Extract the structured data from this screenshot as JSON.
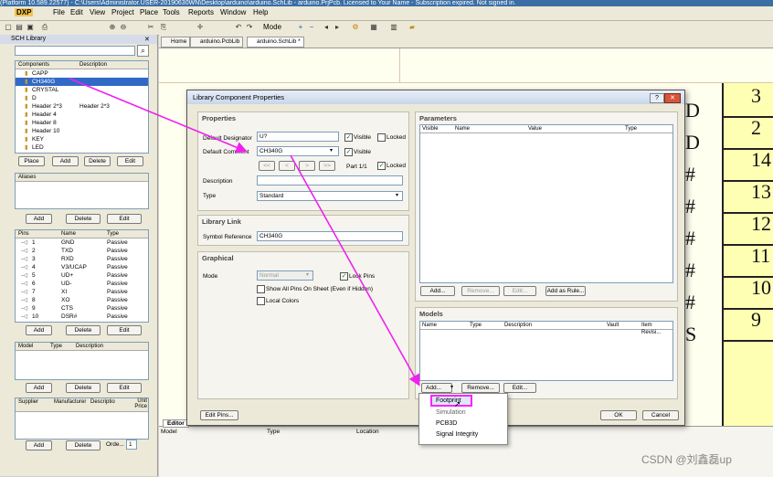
{
  "app": {
    "title": "(Platform 10.589.22577) - C:\\Users\\Administrator.USER-20190630WN\\Desktop\\arduino\\arduino.SchLib - arduino.PrjPcb. Licensed to Your Name - Subscription expired. Not signed in.",
    "logo": "DXP"
  },
  "menu": [
    "File",
    "Edit",
    "View",
    "Project",
    "Place",
    "Tools",
    "Reports",
    "Window",
    "Help"
  ],
  "toolbar": {
    "mode_label": "Mode"
  },
  "sch_library": {
    "title": "SCH Library",
    "components_header": {
      "col1": "Components",
      "col2": "Description"
    },
    "components": [
      {
        "name": "CAPP",
        "desc": ""
      },
      {
        "name": "CH340G",
        "desc": "",
        "selected": true
      },
      {
        "name": "CRYSTAL",
        "desc": ""
      },
      {
        "name": "D",
        "desc": ""
      },
      {
        "name": "Header 2*3",
        "desc": "Header 2*3"
      },
      {
        "name": "Header 4",
        "desc": ""
      },
      {
        "name": "Header 8",
        "desc": ""
      },
      {
        "name": "Header 10",
        "desc": ""
      },
      {
        "name": "KEY",
        "desc": ""
      },
      {
        "name": "LED",
        "desc": ""
      }
    ],
    "comp_buttons": [
      "Place",
      "Add",
      "Delete",
      "Edit"
    ],
    "aliases_header": "Aliases",
    "alias_buttons": [
      "Add",
      "Delete",
      "Edit"
    ],
    "pins_header": {
      "col1": "Pins",
      "col2": "Name",
      "col3": "Type"
    },
    "pins": [
      {
        "num": "1",
        "name": "GND",
        "type": "Passive"
      },
      {
        "num": "2",
        "name": "TXD",
        "type": "Passive"
      },
      {
        "num": "3",
        "name": "RXD",
        "type": "Passive"
      },
      {
        "num": "4",
        "name": "V3/UCAP",
        "type": "Passive"
      },
      {
        "num": "5",
        "name": "UD+",
        "type": "Passive"
      },
      {
        "num": "6",
        "name": "UD-",
        "type": "Passive"
      },
      {
        "num": "7",
        "name": "XI",
        "type": "Passive"
      },
      {
        "num": "8",
        "name": "XO",
        "type": "Passive"
      },
      {
        "num": "9",
        "name": "CTS",
        "type": "Passive"
      },
      {
        "num": "10",
        "name": "DSR#",
        "type": "Passive"
      }
    ],
    "pin_buttons": [
      "Add",
      "Delete",
      "Edit"
    ],
    "model_header": {
      "col1": "Model",
      "col2": "Type",
      "col3": "Description"
    },
    "model_buttons": [
      "Add",
      "Delete",
      "Edit"
    ],
    "supplier_header": {
      "col1": "Supplier",
      "col2": "Manufacturer",
      "col3": "Descriptio",
      "col4": "Unit Price"
    },
    "supplier_buttons": [
      "Add",
      "Delete"
    ],
    "order_label": "Orde...",
    "order_value": "1"
  },
  "tabs": [
    "Home",
    "arduino.PcbLib",
    "arduino.SchLib *"
  ],
  "dialog": {
    "title": "Library Component Properties",
    "properties": {
      "title": "Properties",
      "designator_label": "Default Designator",
      "designator_value": "U?",
      "visible_label": "Visible",
      "locked_label": "Locked",
      "comment_label": "Default Comment",
      "comment_value": "CH340G",
      "part_label": "Part 1/1",
      "description_label": "Description",
      "description_value": "",
      "type_label": "Type",
      "type_value": "Standard",
      "nav": [
        "<<",
        "<",
        ">",
        ">>"
      ]
    },
    "library_link": {
      "title": "Library Link",
      "symbol_label": "Symbol Reference",
      "symbol_value": "CH340G"
    },
    "graphical": {
      "title": "Graphical",
      "mode_label": "Mode",
      "mode_value": "Normal",
      "lock_pins": "Lock Pins",
      "show_all_pins": "Show All Pins On Sheet (Even if Hidden)",
      "local_colors": "Local Colors"
    },
    "parameters": {
      "title": "Parameters",
      "cols": [
        "Visible",
        "Name",
        "Value",
        "Type"
      ],
      "buttons": [
        "Add...",
        "Remove...",
        "Edit...",
        "Add as Rule..."
      ]
    },
    "models": {
      "title": "Models",
      "cols": [
        "Name",
        "Type",
        "Description",
        "Vault",
        "Item Revisi..."
      ],
      "buttons": [
        "Add...",
        "Remove...",
        "Edit..."
      ]
    },
    "edit_pins": "Edit Pins...",
    "ok": "OK",
    "cancel": "Cancel"
  },
  "add_menu": [
    "Footprint",
    "Simulation",
    "PCB3D",
    "Signal Integrity"
  ],
  "schematic": {
    "pin_numbers": [
      "3",
      "2",
      "14",
      "13",
      "12",
      "11",
      "10",
      "9"
    ],
    "pin_letters": [
      "D",
      "D",
      "#",
      "#",
      "#",
      "#",
      "#",
      "S"
    ]
  },
  "editor_tab": "Editor",
  "bottom_cols": [
    "Model",
    "Type",
    "Location"
  ],
  "watermark": "CSDN @刘鑫磊up",
  "colors": {
    "arrow": "#ee22ee",
    "highlight": "#ff22ff",
    "selection": "#3169c6"
  }
}
